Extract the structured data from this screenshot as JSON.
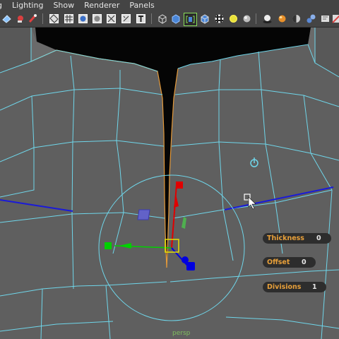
{
  "menubar": {
    "items": [
      {
        "label": "g"
      },
      {
        "label": "Lighting"
      },
      {
        "label": "Show"
      },
      {
        "label": "Renderer"
      },
      {
        "label": "Panels"
      }
    ]
  },
  "toolbar": {
    "icons": [
      "select-camera-icon",
      "camera-attributes-icon",
      "bookmark-icon",
      "wireframe-on-shaded-icon",
      "grid-icon",
      "smooth-shade-icon",
      "flat-shade-icon",
      "xray-icon",
      "uv-icon",
      "text-icon",
      "wireframe-cube-icon",
      "shaded-cube-icon",
      "isolate-select-icon",
      "textured-cube-icon",
      "checker-icon",
      "use-lights-icon",
      "default-light-icon",
      "shadows-icon",
      "ambient-occlusion-icon",
      "motion-blur-icon",
      "anti-aliasing-icon",
      "depth-of-field-icon",
      "panel-options-icon"
    ]
  },
  "viewport": {
    "camera_label": "persp"
  },
  "hud": {
    "thickness": {
      "label": "Thickness",
      "value": "0"
    },
    "offset": {
      "label": "Offset",
      "value": "0"
    },
    "divisions": {
      "label": "Divisions",
      "value": "1"
    }
  },
  "colors": {
    "wire": "#6fd6ea",
    "background": "#5d5d5d",
    "hud_label": "#e8a03a",
    "axis_x": "#e00000",
    "axis_y": "#00d000",
    "axis_z": "#0000e0"
  }
}
